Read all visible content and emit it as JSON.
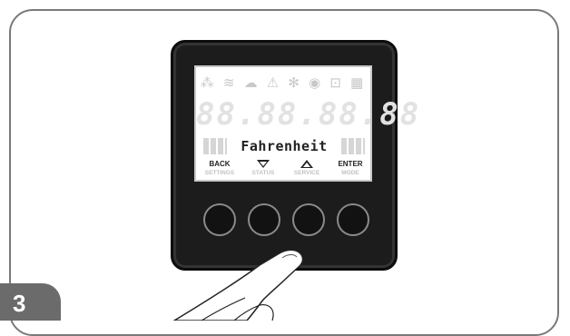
{
  "step": {
    "number": "3"
  },
  "display": {
    "status_icons": [
      "flame-icon",
      "wifi-icon",
      "cloud-icon",
      "warning-icon",
      "fan-icon",
      "sync-icon",
      "lock-icon",
      "storage-icon"
    ],
    "status_glyphs": "⁂ ≋ ☁ ⚠ ✻ ◉ ⊡ ▦",
    "segment_digits": "88.88.88.88",
    "mode_label": "Fahrenheit"
  },
  "buttons": [
    {
      "top": "BACK",
      "bottom": "SETTINGS",
      "symbol": ""
    },
    {
      "top": "",
      "bottom": "STATUS",
      "symbol": "triangle-down-icon"
    },
    {
      "top": "",
      "bottom": "SERVICE",
      "symbol": "triangle-up-icon"
    },
    {
      "top": "ENTER",
      "bottom": "MODE",
      "symbol": ""
    }
  ],
  "colors": {
    "frame": "#7a7a7a",
    "badge": "#6b6b6b",
    "device": "#1c1c1c",
    "screen": "#ffffff",
    "active_text": "#222222",
    "inactive_text": "#c2c2c2"
  },
  "pressed_button": "SERVICE"
}
